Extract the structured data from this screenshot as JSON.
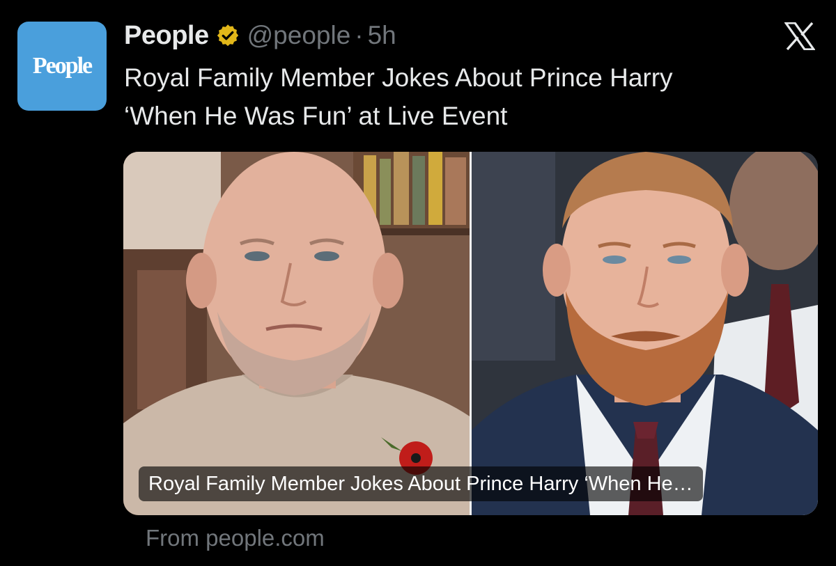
{
  "account": {
    "avatar_logo_text": "People",
    "display_name": "People",
    "verified_icon": "verified-badge-gold",
    "handle": "@people",
    "separator": "·",
    "time": "5h"
  },
  "platform_icon": "x-logo-icon",
  "tweet": {
    "text_line1": "Royal Family Member Jokes About Prince Harry",
    "text_line2": "‘When He Was Fun’ at Live Event"
  },
  "card": {
    "caption": "Royal Family Member Jokes About Prince Harry ‘When He…",
    "source": "From people.com"
  },
  "colors": {
    "background": "#000000",
    "text_primary": "#e7e9ea",
    "text_secondary": "#71767b",
    "avatar_bg": "#4a9fdc",
    "verified_gold": "#e2b719"
  }
}
